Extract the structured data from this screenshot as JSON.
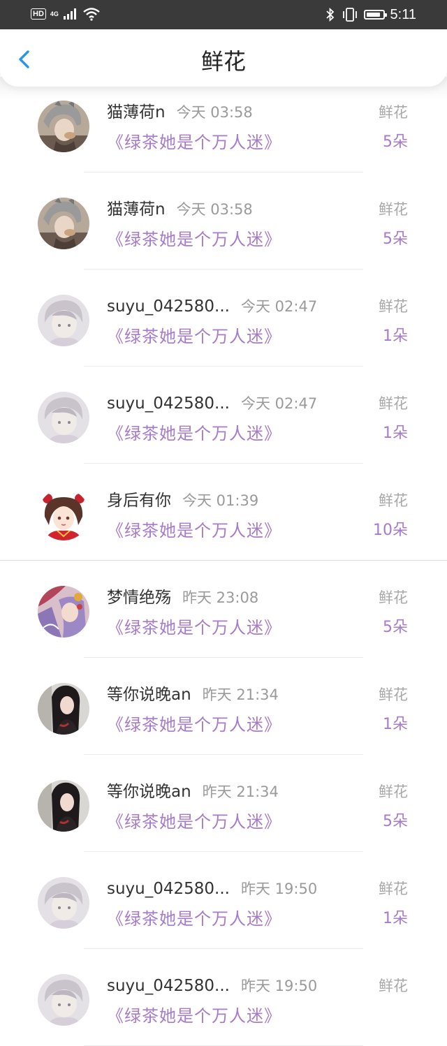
{
  "status_bar": {
    "hd": "HD",
    "network": "4G",
    "time": "5:11",
    "battery_level": 0.9
  },
  "header": {
    "title": "鲜花",
    "back_icon": "chevron-left-icon",
    "accent_color": "#2a94e8"
  },
  "colors": {
    "book_title": "#a77bc9",
    "meta_gray": "#9a9a9a"
  },
  "items": [
    {
      "user": "猫薄荷n",
      "time": "今天 03:58",
      "book": "《绿茶她是个万人迷》",
      "gift": "鲜花",
      "count": "5朵",
      "avatar": "avatar-photo-grey-hat"
    },
    {
      "user": "猫薄荷n",
      "time": "今天 03:58",
      "book": "《绿茶她是个万人迷》",
      "gift": "鲜花",
      "count": "5朵",
      "avatar": "avatar-photo-grey-hat"
    },
    {
      "user": "suyu_042580...",
      "time": "今天 02:47",
      "book": "《绿茶她是个万人迷》",
      "gift": "鲜花",
      "count": "1朵",
      "avatar": "avatar-anime-pale"
    },
    {
      "user": "suyu_042580...",
      "time": "今天 02:47",
      "book": "《绿茶她是个万人迷》",
      "gift": "鲜花",
      "count": "1朵",
      "avatar": "avatar-anime-pale"
    },
    {
      "user": "身后有你",
      "time": "今天 01:39",
      "book": "《绿茶她是个万人迷》",
      "gift": "鲜花",
      "count": "10朵",
      "avatar": "avatar-anime-red-girl"
    },
    {
      "user": "梦情绝殇",
      "time": "昨天 23:08",
      "book": "《绿茶她是个万人迷》",
      "gift": "鲜花",
      "count": "5朵",
      "avatar": "avatar-anime-purple"
    },
    {
      "user": "等你说晚an",
      "time": "昨天 21:34",
      "book": "《绿茶她是个万人迷》",
      "gift": "鲜花",
      "count": "1朵",
      "avatar": "avatar-photo-dark-hair"
    },
    {
      "user": "等你说晚an",
      "time": "昨天 21:34",
      "book": "《绿茶她是个万人迷》",
      "gift": "鲜花",
      "count": "5朵",
      "avatar": "avatar-photo-dark-hair"
    },
    {
      "user": "suyu_042580...",
      "time": "昨天 19:50",
      "book": "《绿茶她是个万人迷》",
      "gift": "鲜花",
      "count": "1朵",
      "avatar": "avatar-anime-pale"
    },
    {
      "user": "suyu_042580...",
      "time": "昨天 19:50",
      "book": "《绿茶她是个万人迷》",
      "gift": "鲜花",
      "count": "",
      "avatar": "avatar-anime-pale"
    }
  ]
}
